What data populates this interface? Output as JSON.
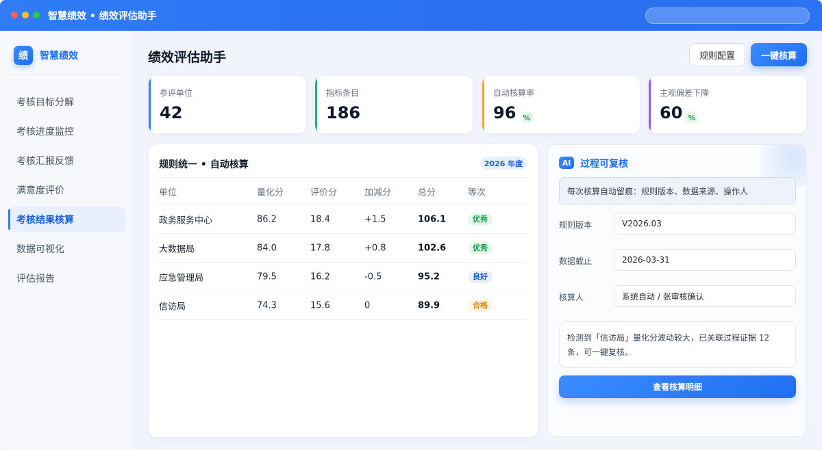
{
  "window": {
    "title": "智慧绩效 • 绩效评估助手",
    "search_placeholder": ""
  },
  "sidebar": {
    "brand_logo": "绩",
    "brand_name": "智慧绩效",
    "items": [
      {
        "label": "考核目标分解",
        "active": false
      },
      {
        "label": "考核进度监控",
        "active": false
      },
      {
        "label": "考核汇报反馈",
        "active": false
      },
      {
        "label": "满意度评价",
        "active": false
      },
      {
        "label": "考核结果核算",
        "active": true
      },
      {
        "label": "数据可视化",
        "active": false
      },
      {
        "label": "评估报告",
        "active": false
      }
    ]
  },
  "header": {
    "title": "绩效评估助手",
    "config_button": "规则配置",
    "calc_button": "一键核算"
  },
  "stats": [
    {
      "label": "参评单位",
      "value": "42",
      "unit": "",
      "color": "#2f7cf6"
    },
    {
      "label": "指标条目",
      "value": "186",
      "unit": "",
      "color": "#22b36b"
    },
    {
      "label": "自动核算率",
      "value": "96",
      "unit": "%",
      "color": "#f5a524"
    },
    {
      "label": "主观偏差下降",
      "value": "60",
      "unit": "%",
      "color": "#8b5cf6"
    }
  ],
  "table": {
    "title": "规则统一 • 自动核算",
    "year_badge": "2026 年度",
    "columns": [
      "单位",
      "量化分",
      "评价分",
      "加减分",
      "总分",
      "等次"
    ],
    "rows": [
      {
        "unit": "政务服务中心",
        "quant": "86.2",
        "eval": "18.4",
        "adj": "+1.5",
        "total": "106.1",
        "grade": "优秀",
        "grade_bg": "#e8f7ee",
        "grade_fg": "#16a34a"
      },
      {
        "unit": "大数据局",
        "quant": "84.0",
        "eval": "17.8",
        "adj": "+0.8",
        "total": "102.6",
        "grade": "优秀",
        "grade_bg": "#e8f7ee",
        "grade_fg": "#16a34a"
      },
      {
        "unit": "应急管理局",
        "quant": "79.5",
        "eval": "16.2",
        "adj": "-0.5",
        "total": "95.2",
        "grade": "良好",
        "grade_bg": "#e8f0fe",
        "grade_fg": "#1d5fd6"
      },
      {
        "unit": "信访局",
        "quant": "74.3",
        "eval": "15.6",
        "adj": "0",
        "total": "89.9",
        "grade": "合格",
        "grade_bg": "#fdf4e3",
        "grade_fg": "#d98a0b"
      }
    ]
  },
  "review": {
    "ai_badge": "AI",
    "title": "过程可复核",
    "note": "每次核算自动留痕：规则版本、数据来源、操作人",
    "fields": [
      {
        "label": "规则版本",
        "value": "V2026.03"
      },
      {
        "label": "数据截止",
        "value": "2026-03-31"
      },
      {
        "label": "核算人",
        "value": "系统自动 / 张审核确认"
      }
    ],
    "alert": "检测到「信访局」量化分波动较大，已关联过程证据 12 条，可一键复核。",
    "detail_button": "查看核算明细"
  }
}
